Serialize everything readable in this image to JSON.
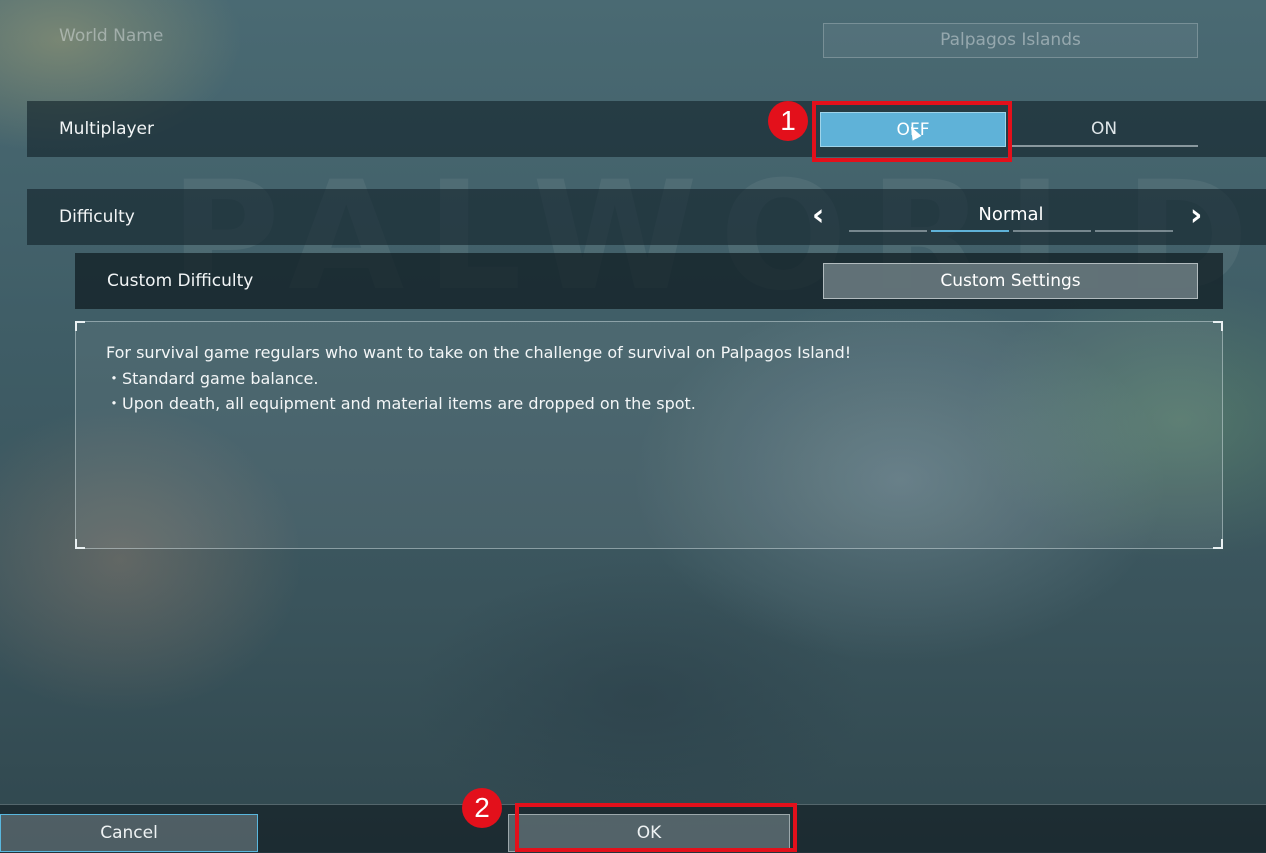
{
  "world_name": {
    "label": "World Name",
    "value": "Palpagos Islands"
  },
  "background": {
    "watermark": "PALWORLD"
  },
  "multiplayer": {
    "label": "Multiplayer",
    "off_label": "OFF",
    "on_label": "ON",
    "selected": "OFF"
  },
  "difficulty": {
    "label": "Difficulty",
    "value": "Normal",
    "prev_icon": "chevron-left-icon",
    "next_icon": "chevron-right-icon",
    "level_count": 4,
    "selected_level_index": 2
  },
  "custom_difficulty": {
    "label": "Custom Difficulty",
    "button_label": "Custom Settings"
  },
  "description": {
    "lines": [
      "For survival game regulars who want to take on the challenge of survival on Palpagos Island!",
      "・Standard game balance.",
      "・Upon death, all equipment and material items are dropped on the spot."
    ]
  },
  "footer": {
    "cancel_label": "Cancel",
    "ok_label": "OK"
  },
  "annotations": {
    "step1": "1",
    "step2": "2",
    "highlight_color": "#e3101b"
  },
  "colors": {
    "accent": "#5fb2d8",
    "annotation": "#e3101b"
  }
}
